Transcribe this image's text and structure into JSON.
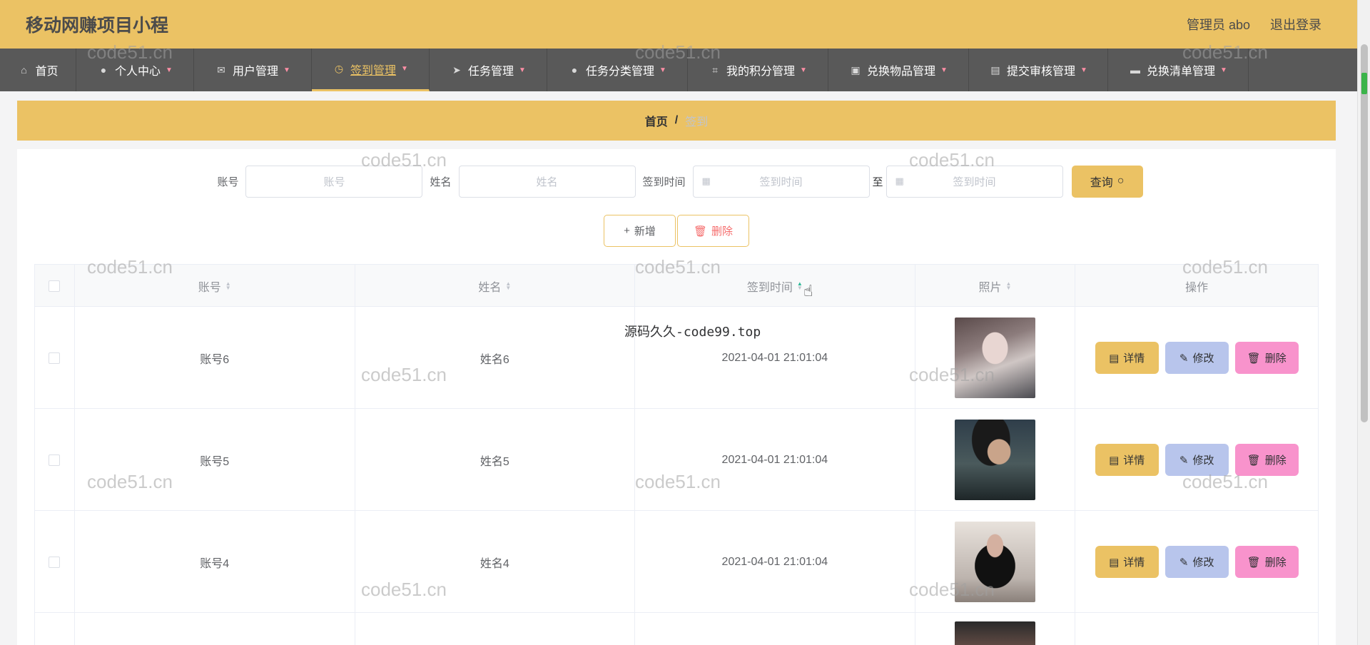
{
  "app": {
    "title": "移动网赚项目小程"
  },
  "header": {
    "user_label": "管理员 abo",
    "logout_label": "退出登录"
  },
  "nav": {
    "items": [
      {
        "label": "首页",
        "icon": "home-icon",
        "has_dropdown": false
      },
      {
        "label": "个人中心",
        "icon": "user-icon",
        "has_dropdown": true
      },
      {
        "label": "用户管理",
        "icon": "mail-icon",
        "has_dropdown": true
      },
      {
        "label": "签到管理",
        "icon": "clock-icon",
        "has_dropdown": true,
        "active": true
      },
      {
        "label": "任务管理",
        "icon": "send-icon",
        "has_dropdown": true
      },
      {
        "label": "任务分类管理",
        "icon": "user-icon",
        "has_dropdown": true
      },
      {
        "label": "我的积分管理",
        "icon": "crop-icon",
        "has_dropdown": true
      },
      {
        "label": "兑换物品管理",
        "icon": "briefcase-icon",
        "has_dropdown": true
      },
      {
        "label": "提交审核管理",
        "icon": "clipboard-icon",
        "has_dropdown": true
      },
      {
        "label": "兑换清单管理",
        "icon": "monitor-icon",
        "has_dropdown": true
      }
    ]
  },
  "breadcrumb": {
    "home": "首页",
    "separator": "/",
    "current": "签到"
  },
  "search": {
    "account_label": "账号",
    "account_placeholder": "账号",
    "name_label": "姓名",
    "name_placeholder": "姓名",
    "time_label": "签到时间",
    "time_start_placeholder": "签到时间",
    "to_label": "至",
    "time_end_placeholder": "签到时间",
    "query_label": "查询"
  },
  "actions": {
    "add_label": "新增",
    "delete_label": "删除"
  },
  "table": {
    "headers": {
      "account": "账号",
      "name": "姓名",
      "sign_time": "签到时间",
      "photo": "照片",
      "ops": "操作"
    },
    "rows": [
      {
        "account": "账号6",
        "name": "姓名6",
        "sign_time": "2021-04-01 21:01:04"
      },
      {
        "account": "账号5",
        "name": "姓名5",
        "sign_time": "2021-04-01 21:01:04"
      },
      {
        "account": "账号4",
        "name": "姓名4",
        "sign_time": "2021-04-01 21:01:04"
      }
    ],
    "op_labels": {
      "detail": "详情",
      "edit": "修改",
      "delete": "删除"
    }
  },
  "watermark_text": "code51.cn",
  "center_watermark": "源码久久-code99.top",
  "colors": {
    "accent": "#ebc264",
    "nav_bg": "#595959",
    "edit": "#b8c5ec",
    "delete": "#f893cc"
  }
}
